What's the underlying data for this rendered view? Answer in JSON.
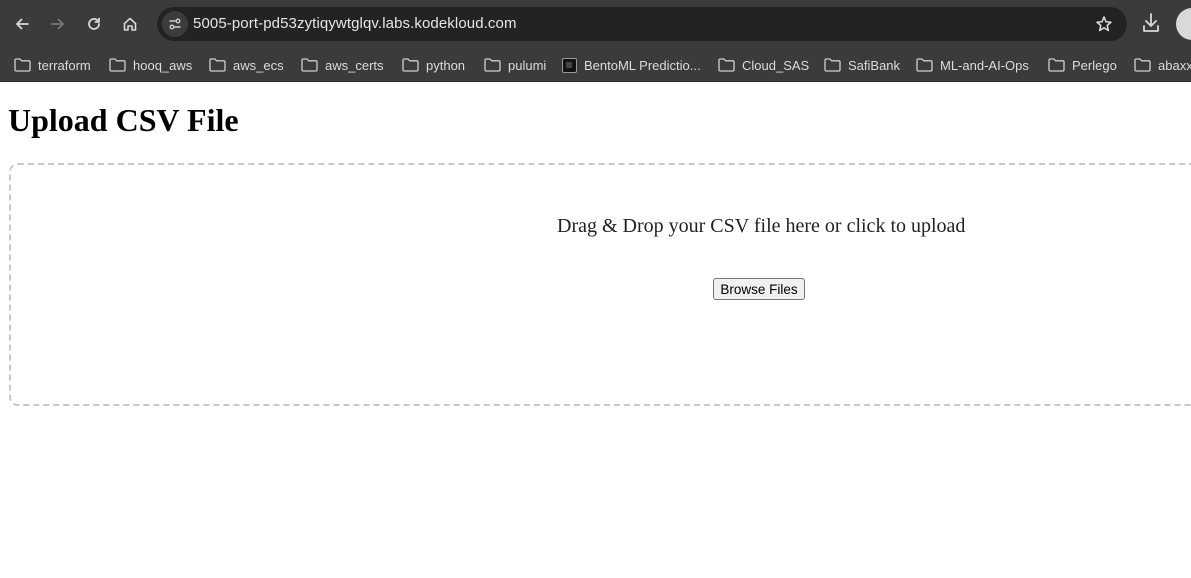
{
  "browser": {
    "url": "5005-port-pd53zytiqywtglqv.labs.kodekloud.com",
    "icons": [
      "back-icon",
      "forward-icon",
      "reload-icon",
      "home-icon",
      "site-info-icon",
      "star-icon",
      "download-icon"
    ],
    "bookmarks": [
      {
        "label": "terraform",
        "icon": "folder-icon"
      },
      {
        "label": "hooq_aws",
        "icon": "folder-icon"
      },
      {
        "label": "aws_ecs",
        "icon": "folder-icon"
      },
      {
        "label": "aws_certs",
        "icon": "folder-icon"
      },
      {
        "label": "python",
        "icon": "folder-icon"
      },
      {
        "label": "pulumi",
        "icon": "folder-icon"
      },
      {
        "label": "BentoML Predictio...",
        "icon": "bentoml-favicon"
      },
      {
        "label": "Cloud_SAS",
        "icon": "folder-icon"
      },
      {
        "label": "SafiBank",
        "icon": "folder-icon"
      },
      {
        "label": "ML-and-AI-Ops",
        "icon": "folder-icon"
      },
      {
        "label": "Perlego",
        "icon": "folder-icon"
      },
      {
        "label": "abaxx",
        "icon": "folder-icon"
      }
    ]
  },
  "page": {
    "title": "Upload CSV File",
    "dropzone": {
      "text": "Drag & Drop your CSV file here or click to upload",
      "button_label": "Browse Files"
    }
  },
  "colors": {
    "chrome_bg": "#3b3b3b",
    "omnibox_bg": "#232323",
    "dropzone_border": "#c8c8c8"
  }
}
